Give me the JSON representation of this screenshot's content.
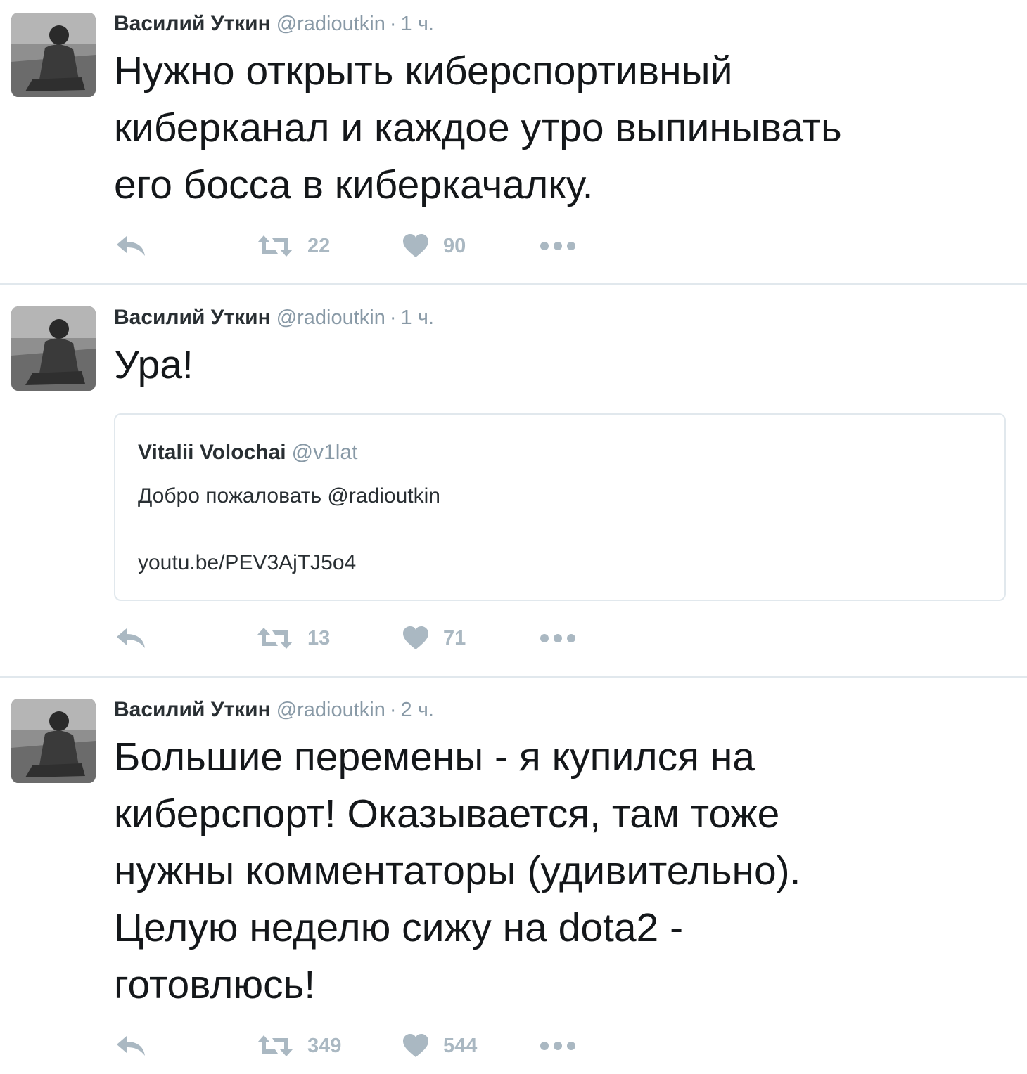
{
  "colors": {
    "text": "#14171a",
    "name": "#292f33",
    "secondary": "#8899a6",
    "action": "#aab8c2",
    "divider": "#e1e8ed"
  },
  "tweets": [
    {
      "author": "Василий Уткин",
      "handle": "@radioutkin",
      "separator": "·",
      "time": "1 ч.",
      "text": "Нужно открыть киберспортивный\nкиберканал и каждое утро выпинывать\nего босса в киберкачалку.",
      "retweets": "22",
      "likes": "90",
      "icons": [
        "reply-icon",
        "retweet-icon",
        "heart-icon",
        "more-icon"
      ]
    },
    {
      "author": "Василий Уткин",
      "handle": "@radioutkin",
      "separator": "·",
      "time": "1 ч.",
      "text": "Ура!",
      "quote": {
        "author": "Vitalii Volochai",
        "handle": "@v1lat",
        "text": "Добро пожаловать @radioutkin",
        "link": "youtu.be/PEV3AjTJ5o4"
      },
      "retweets": "13",
      "likes": "71",
      "icons": [
        "reply-icon",
        "retweet-icon",
        "heart-icon",
        "more-icon"
      ]
    },
    {
      "author": "Василий Уткин",
      "handle": "@radioutkin",
      "separator": "·",
      "time": "2 ч.",
      "text": "Большие перемены - я купился на\nкиберспорт! Оказывается, там тоже\nнужны комментаторы (удивительно).\nЦелую неделю сижу на dota2 -\nготовлюсь!",
      "retweets": "349",
      "likes": "544",
      "icons": [
        "reply-icon",
        "retweet-icon",
        "heart-icon",
        "more-icon"
      ]
    }
  ]
}
